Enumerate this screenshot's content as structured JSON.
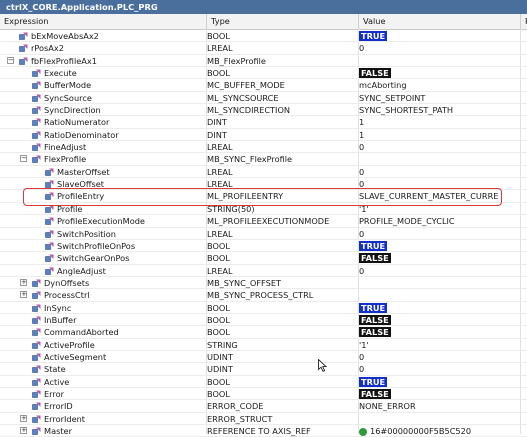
{
  "window": {
    "title": "ctrlX_CORE.Application.PLC_PRG"
  },
  "columns": {
    "expression": "Expression",
    "type": "Type",
    "value": "Value",
    "extra": "P"
  },
  "rows": [
    {
      "name": "bExMoveAbsAx2",
      "type": "BOOL",
      "value": "TRUE",
      "badge": "true",
      "depth": 0,
      "expander": ""
    },
    {
      "name": "rPosAx2",
      "type": "LREAL",
      "value": "0",
      "badge": "",
      "depth": 0,
      "expander": ""
    },
    {
      "name": "fbFlexProfileAx1",
      "type": "MB_FlexProfile",
      "value": "",
      "badge": "",
      "depth": 0,
      "expander": "minus"
    },
    {
      "name": "Execute",
      "type": "BOOL",
      "value": "FALSE",
      "badge": "false",
      "depth": 1,
      "expander": ""
    },
    {
      "name": "BufferMode",
      "type": "MC_BUFFER_MODE",
      "value": "mcAborting",
      "badge": "",
      "depth": 1,
      "expander": ""
    },
    {
      "name": "SyncSource",
      "type": "ML_SYNCSOURCE",
      "value": "SYNC_SETPOINT",
      "badge": "",
      "depth": 1,
      "expander": ""
    },
    {
      "name": "SyncDirection",
      "type": "ML_SYNCDIRECTION",
      "value": "SYNC_SHORTEST_PATH",
      "badge": "",
      "depth": 1,
      "expander": ""
    },
    {
      "name": "RatioNumerator",
      "type": "DINT",
      "value": "1",
      "badge": "",
      "depth": 1,
      "expander": ""
    },
    {
      "name": "RatioDenominator",
      "type": "DINT",
      "value": "1",
      "badge": "",
      "depth": 1,
      "expander": ""
    },
    {
      "name": "FineAdjust",
      "type": "LREAL",
      "value": "0",
      "badge": "",
      "depth": 1,
      "expander": ""
    },
    {
      "name": "FlexProfile",
      "type": "MB_SYNC_FlexProfile",
      "value": "",
      "badge": "",
      "depth": 1,
      "expander": "minus"
    },
    {
      "name": "MasterOffset",
      "type": "LREAL",
      "value": "0",
      "badge": "",
      "depth": 2,
      "expander": ""
    },
    {
      "name": "SlaveOffset",
      "type": "LREAL",
      "value": "0",
      "badge": "",
      "depth": 2,
      "expander": ""
    },
    {
      "name": "ProfileEntry",
      "type": "ML_PROFILEENTRY",
      "value": "SLAVE_CURRENT_MASTER_CURRENT",
      "badge": "",
      "depth": 2,
      "expander": ""
    },
    {
      "name": "Profile",
      "type": "STRING(50)",
      "value": "'1'",
      "badge": "",
      "depth": 2,
      "expander": ""
    },
    {
      "name": "ProfileExecutionMode",
      "type": "ML_PROFILEEXECUTIONMODE",
      "value": "PROFILE_MODE_CYCLIC",
      "badge": "",
      "depth": 2,
      "expander": ""
    },
    {
      "name": "SwitchPosition",
      "type": "LREAL",
      "value": "0",
      "badge": "",
      "depth": 2,
      "expander": ""
    },
    {
      "name": "SwitchProfileOnPos",
      "type": "BOOL",
      "value": "TRUE",
      "badge": "true",
      "depth": 2,
      "expander": ""
    },
    {
      "name": "SwitchGearOnPos",
      "type": "BOOL",
      "value": "FALSE",
      "badge": "false",
      "depth": 2,
      "expander": ""
    },
    {
      "name": "AngleAdjust",
      "type": "LREAL",
      "value": "0",
      "badge": "",
      "depth": 2,
      "expander": ""
    },
    {
      "name": "DynOffsets",
      "type": "MB_SYNC_OFFSET",
      "value": "",
      "badge": "",
      "depth": 1,
      "expander": "plus"
    },
    {
      "name": "ProcessCtrl",
      "type": "MB_SYNC_PROCESS_CTRL",
      "value": "",
      "badge": "",
      "depth": 1,
      "expander": "plus"
    },
    {
      "name": "InSync",
      "type": "BOOL",
      "value": "TRUE",
      "badge": "true",
      "depth": 1,
      "expander": ""
    },
    {
      "name": "InBuffer",
      "type": "BOOL",
      "value": "FALSE",
      "badge": "false",
      "depth": 1,
      "expander": ""
    },
    {
      "name": "CommandAborted",
      "type": "BOOL",
      "value": "FALSE",
      "badge": "false",
      "depth": 1,
      "expander": ""
    },
    {
      "name": "ActiveProfile",
      "type": "STRING",
      "value": "'1'",
      "badge": "",
      "depth": 1,
      "expander": ""
    },
    {
      "name": "ActiveSegment",
      "type": "UDINT",
      "value": "0",
      "badge": "",
      "depth": 1,
      "expander": ""
    },
    {
      "name": "State",
      "type": "UDINT",
      "value": "0",
      "badge": "",
      "depth": 1,
      "expander": ""
    },
    {
      "name": "Active",
      "type": "BOOL",
      "value": "TRUE",
      "badge": "true",
      "depth": 1,
      "expander": ""
    },
    {
      "name": "Error",
      "type": "BOOL",
      "value": "FALSE",
      "badge": "false",
      "depth": 1,
      "expander": ""
    },
    {
      "name": "ErrorID",
      "type": "ERROR_CODE",
      "value": "NONE_ERROR",
      "badge": "",
      "depth": 1,
      "expander": ""
    },
    {
      "name": "ErrorIdent",
      "type": "ERROR_STRUCT",
      "value": "",
      "badge": "",
      "depth": 1,
      "expander": "plus"
    },
    {
      "name": "Master",
      "type": "REFERENCE TO AXIS_REF",
      "value": "16#00000000F5B5C520",
      "badge": "online",
      "depth": 1,
      "expander": "plus"
    }
  ],
  "colors": {
    "titlebar": "#4a6f9c",
    "true_badge": "#1030c8",
    "false_badge": "#111111",
    "highlight": "#d63a3a"
  },
  "icons": {
    "variable": "variable-icon",
    "cursor": "mouse-pointer-icon"
  }
}
